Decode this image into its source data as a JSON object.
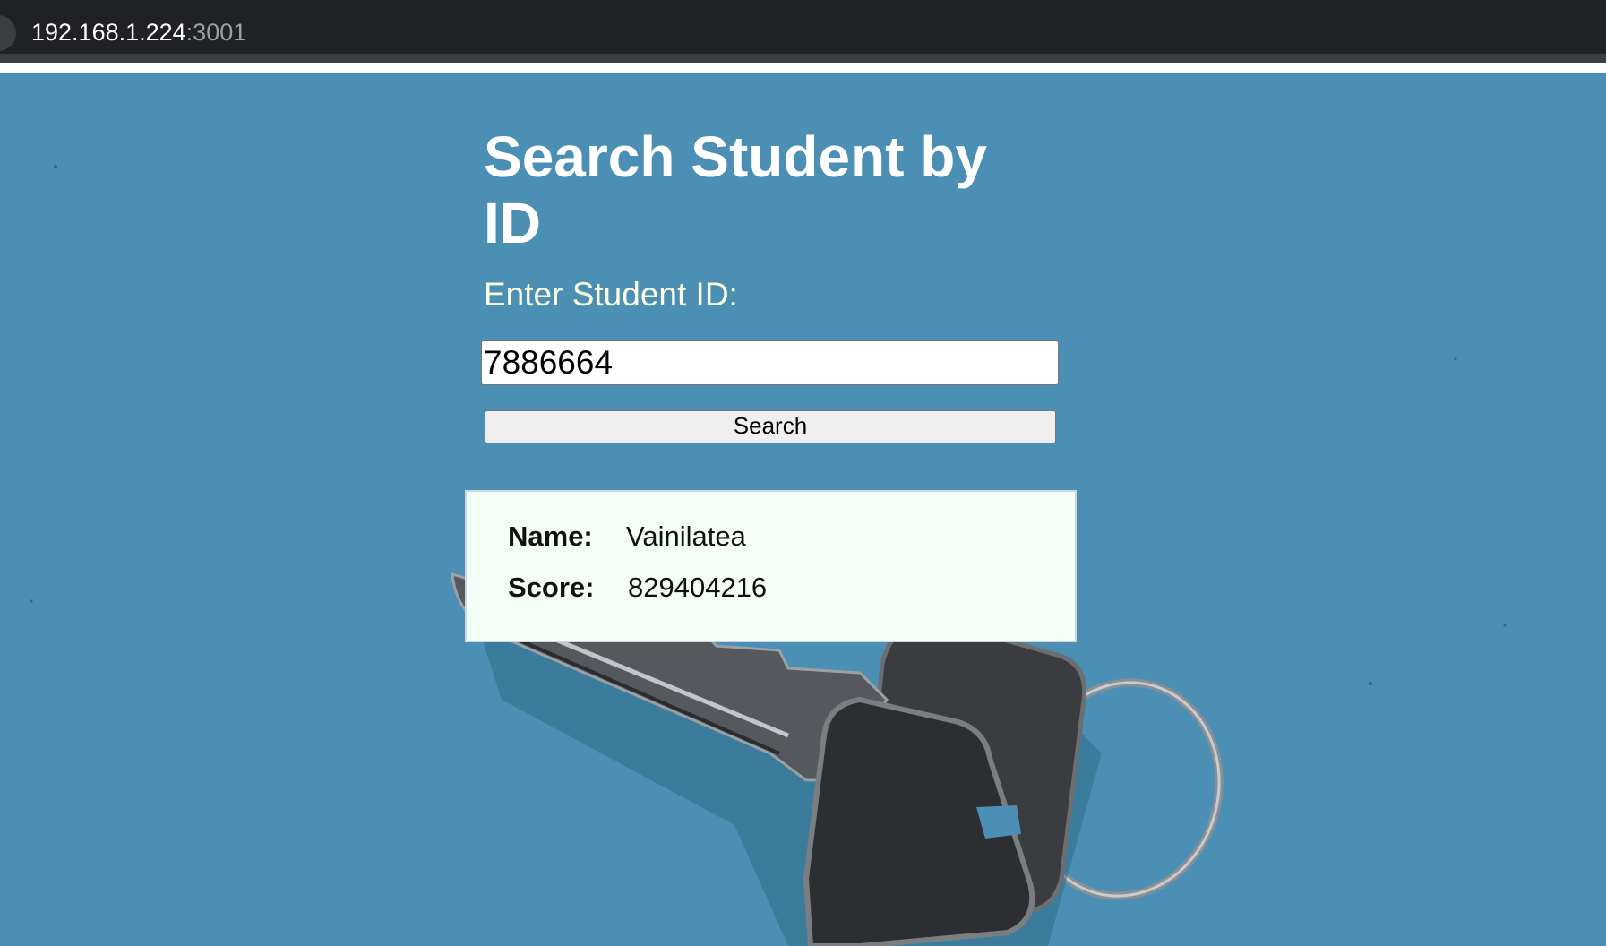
{
  "browser": {
    "url_host": "192.168.1.224",
    "url_port": ":3001"
  },
  "page": {
    "heading": "Search Student by ID",
    "input_label": "Enter Student ID:",
    "student_id_value": "7886664",
    "search_button_label": "Search"
  },
  "result": {
    "name_label": "Name:",
    "name_value": "Vainilatea",
    "score_label": "Score:",
    "score_value": "829404216"
  },
  "colors": {
    "background": "#4b90b4",
    "heading": "#ffffff",
    "label": "#fdfde0",
    "result_card": "#f4fff8",
    "browser_bar": "#202124"
  }
}
